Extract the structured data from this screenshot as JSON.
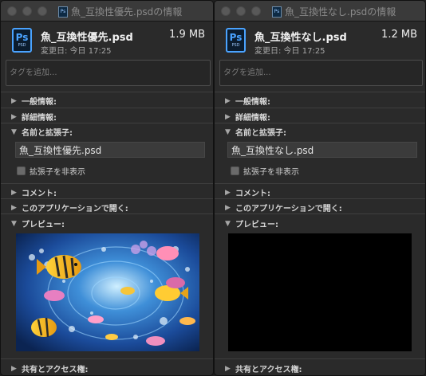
{
  "windows": [
    {
      "title": "魚_互換性優先.psdの情報",
      "icon_label": "Ps",
      "icon_sub": "PSD",
      "filename": "魚_互換性優先.psd",
      "size": "1.9 MB",
      "modified": "変更日: 今日 17:25",
      "tags_placeholder": "タグを追加...",
      "sections": {
        "general": "一般情報:",
        "details": "詳細情報:",
        "name_ext": "名前と拡張子:",
        "comments": "コメント:",
        "open_with": "このアプリケーションで開く:",
        "preview": "プレビュー:",
        "sharing": "共有とアクセス権:"
      },
      "name_value": "魚_互換性優先.psd",
      "hide_ext_label": "拡張子を非表示",
      "preview_icon": "colorful-fish-underwater-image"
    },
    {
      "title": "魚_互換性なし.psdの情報",
      "icon_label": "Ps",
      "icon_sub": "PSD",
      "filename": "魚_互換性なし.psd",
      "size": "1.2 MB",
      "modified": "変更日: 今日 17:25",
      "tags_placeholder": "タグを追加...",
      "sections": {
        "general": "一般情報:",
        "details": "詳細情報:",
        "name_ext": "名前と拡張子:",
        "comments": "コメント:",
        "open_with": "このアプリケーションで開く:",
        "preview": "プレビュー:",
        "sharing": "共有とアクセス権:"
      },
      "name_value": "魚_互換性なし.psd",
      "hide_ext_label": "拡張子を非表示",
      "preview_icon": "black-empty-preview"
    }
  ],
  "colors": {
    "ps_blue": "#4aa3ff",
    "window_bg": "#2a2a2a",
    "titlebar_bg": "#3a3a3a"
  }
}
